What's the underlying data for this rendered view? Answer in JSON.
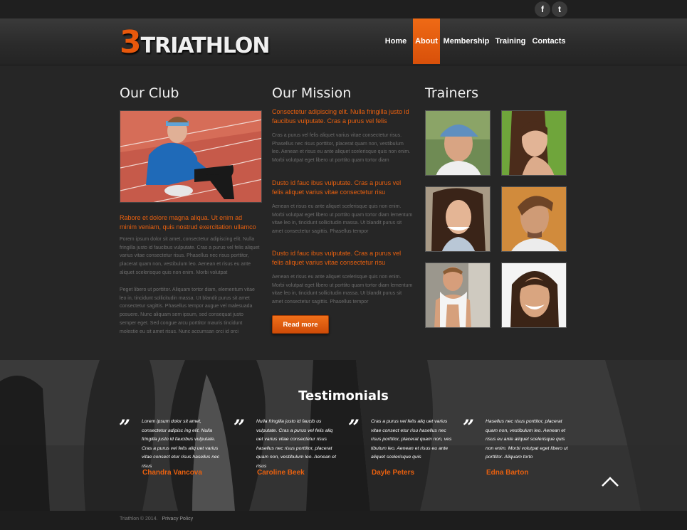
{
  "social": {
    "facebook": "f",
    "twitter": "t"
  },
  "logo": {
    "number": "3",
    "word": "TRIATHLON"
  },
  "nav": [
    {
      "label": "Home",
      "active": false
    },
    {
      "label": "About",
      "active": true
    },
    {
      "label": "Membership",
      "active": false
    },
    {
      "label": "Training",
      "active": false
    },
    {
      "label": "Contacts",
      "active": false
    }
  ],
  "club": {
    "title": "Our Club",
    "highlight": "Rabore et dolore magna aliqua. Ut enim ad minim veniam, quis nostrud exercitation ullamco",
    "para1": "Porem ipsum dolor sit amet, consectetur adipiscing elit. Nulla fringilla justo id faucibus vulputate. Cras a purus vel felis aliquet varius vitae consectetur risus. Phasellus nec risus porttitor, placerat quam non, vestibulum leo. Aenean et risus eu ante aliquet scelerisque quis non enim. Morbi volutpat",
    "para2": "Peget libero ut porttitor. Aliquam tortor diam, elementum vitae leo in, tincidunt sollicitudin massa. Ut blandit purus sit amet consectetur sagittis. Phasellus tempor augue vel malesuada posuere. Nunc aliquam sem ipsum, sed consequat justo semper eget. Sed congue arcu porttitor mauris tincidunt molestie eu sit amet risus. Nunc accumsan orci id orci"
  },
  "mission": {
    "title": "Our Mission",
    "blocks": [
      {
        "head": "Consectetur adipiscing elit. Nulla fringilla justo id faucibus vulputate. Cras a purus vel felis",
        "body": "Cras a purus vel felis aliquet varius vitae consectetur risus. Phasellus nec risus porttitor, placerat quam non, vestibulum leo. Aenean et risus eu ante aliquet scelerisque quis non enim. Morbi volutpat eget libero ut porttito quam tortor diam"
      },
      {
        "head": "Dusto id fauc ibus vulputate. Cras a purus vel felis aliquet varius vitae consectetur risu",
        "body": "Aenean et risus eu ante aliquet scelerisque quis non enim. Morbi volutpat eget libero ut porttito quam tortor diam lementum vitae leo in, tincidunt sollicitudin massa. Ut blandit purus sit amet consectetur sagittis. Phasellus tempor"
      },
      {
        "head": "Dusto id fauc ibus vulputate. Cras a purus vel felis aliquet varius vitae consectetur risu",
        "body": "Aenean et risus eu ante aliquet scelerisque quis non enim. Morbi volutpat eget libero ut porttito quam tortor diam lementum vitae leo in, tincidunt sollicitudin massa. Ut blandit purus sit amet consectetur sagittis. Phasellus tempor"
      }
    ],
    "button": "Read more"
  },
  "trainers": {
    "title": "Trainers"
  },
  "testimonials": {
    "title": "Testimonials",
    "mark": "”",
    "items": [
      {
        "text": "Lorem ipsum dolor sit amet, consectetur adipisc ing elit. Nulla fringilla justo id faucibus vulputate. Cras a purus vel felis aliq uet varius vitae consect etur risus hasellus nec risus",
        "name": "Chandra Vancova"
      },
      {
        "text": "Nulla fringilla justo id faucib us vulputate. Cras a purus vel felis aliq uet varius vitae consectetur risus hasellus nec risus porttitor, placerat quam non, vestibulum leo. Aenean et risus",
        "name": "Caroline Beek"
      },
      {
        "text": "Cras a purus vel felis aliq uet varius vitae consect etur risu hasellus nec risus porttitor, placerat quam non, ves tibulum leo. Aenean et risus eu ante aliquet scelerisque quis",
        "name": "Dayle Peters"
      },
      {
        "text": "Hasellus nec risus porttitor, placerat quam non, vestibulum leo. Aenean et risus eu ante aliquet scelerisque quis non enim. Morbi volutpat eget libero ut porttitor. Aliquam torto",
        "name": "Edna Barton"
      }
    ]
  },
  "footer": {
    "copyright": "Triathlon © 2014.",
    "privacy": "Privacy Policy"
  }
}
